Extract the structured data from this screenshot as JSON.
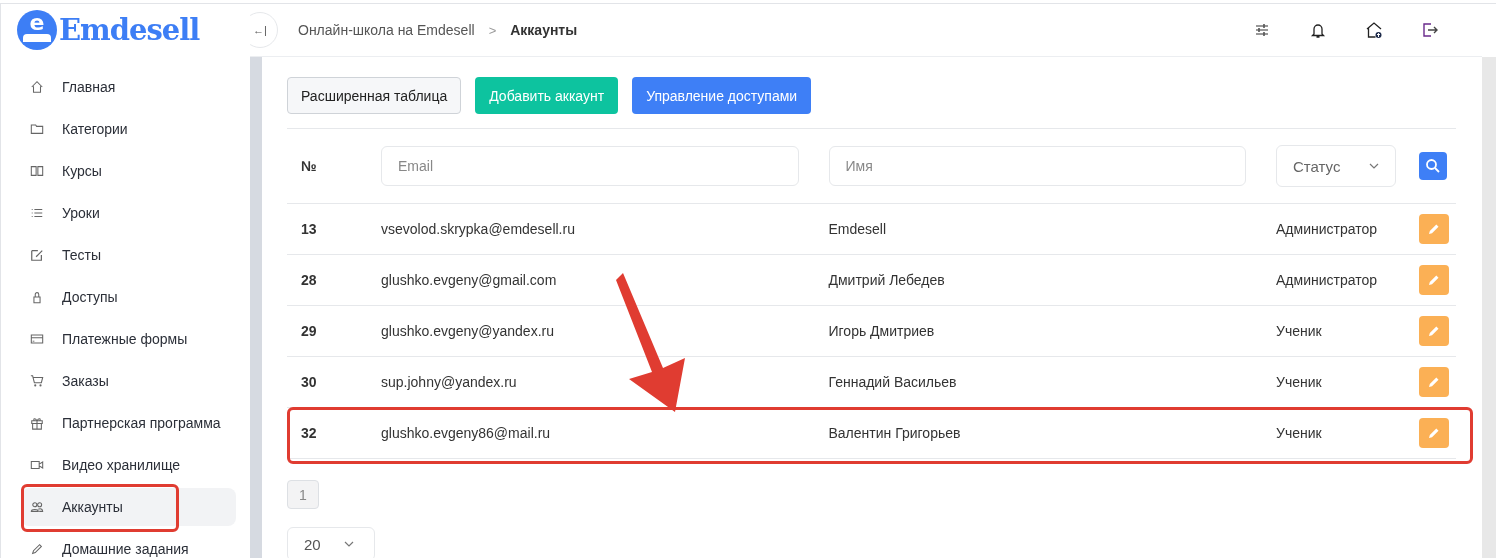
{
  "logo": {
    "letter": "e",
    "name": "Emdesell"
  },
  "sidebar": {
    "items": [
      {
        "label": "Главная",
        "selected": false,
        "annotated": false
      },
      {
        "label": "Категории",
        "selected": false,
        "annotated": false
      },
      {
        "label": "Курсы",
        "selected": false,
        "annotated": false
      },
      {
        "label": "Уроки",
        "selected": false,
        "annotated": false
      },
      {
        "label": "Тесты",
        "selected": false,
        "annotated": false
      },
      {
        "label": "Доступы",
        "selected": false,
        "annotated": false
      },
      {
        "label": "Платежные формы",
        "selected": false,
        "annotated": false
      },
      {
        "label": "Заказы",
        "selected": false,
        "annotated": false
      },
      {
        "label": "Партнерская программа",
        "selected": false,
        "annotated": false
      },
      {
        "label": "Видео хранилище",
        "selected": false,
        "annotated": false
      },
      {
        "label": "Аккаунты",
        "selected": true,
        "annotated": true
      },
      {
        "label": "Домашние задания",
        "selected": false,
        "annotated": false
      }
    ]
  },
  "header": {
    "collapse_icon": "←|",
    "breadcrumbs": [
      {
        "label": "Онлайн-школа на Emdesell",
        "current": false
      },
      {
        "label": "Аккаунты",
        "current": true
      }
    ],
    "separator": ">"
  },
  "toolbar": {
    "buttons": [
      {
        "label": "Расширенная таблица",
        "kind": "light"
      },
      {
        "label": "Добавить аккаунт",
        "kind": "success"
      },
      {
        "label": "Управление доступами",
        "kind": "primary"
      }
    ]
  },
  "table": {
    "number_header": "№",
    "filters": {
      "email_placeholder": "Email",
      "name_placeholder": "Имя",
      "status_value": "Статус"
    },
    "rows": [
      {
        "id": "13",
        "email": "vsevolod.skrypka@emdesell.ru",
        "name": "Emdesell",
        "status": "Администратор",
        "annotated": false
      },
      {
        "id": "28",
        "email": "glushko.evgeny@gmail.com",
        "name": "Дмитрий Лебедев",
        "status": "Администратор",
        "annotated": false
      },
      {
        "id": "29",
        "email": "glushko.evgeny@yandex.ru",
        "name": "Игорь Дмитриев",
        "status": "Ученик",
        "annotated": false
      },
      {
        "id": "30",
        "email": "sup.johny@yandex.ru",
        "name": "Геннадий Васильев",
        "status": "Ученик",
        "annotated": false
      },
      {
        "id": "32",
        "email": "glushko.evgeny86@mail.ru",
        "name": "Валентин Григорьев",
        "status": "Ученик",
        "annotated": true
      }
    ]
  },
  "pagination": {
    "pages": [
      {
        "label": "1",
        "selected": true
      }
    ],
    "page_size": "20"
  }
}
